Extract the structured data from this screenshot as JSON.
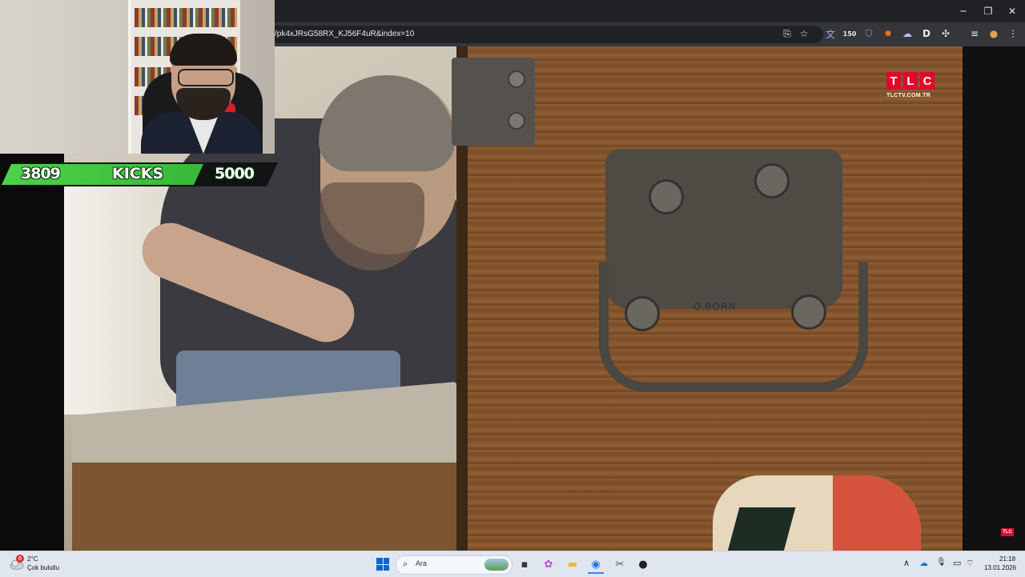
{
  "browser": {
    "url": "/pk4xJRsG58RX_KJ56F4uR&index=10",
    "window_controls": {
      "minimize": "─",
      "maximize": "❐",
      "close": "✕"
    },
    "toolbar_icons": {
      "install": "⎘",
      "bookmark": "☆",
      "translate": "文",
      "badge_count": "150",
      "shield": "⛉",
      "fox": "✹",
      "cloud": "☁",
      "d_ext": "D",
      "extensions": "✣",
      "media": "≡",
      "profile": "●",
      "menu": "⋮"
    }
  },
  "overlay": {
    "kicks_current": "3809",
    "kicks_label": "KICKS",
    "kicks_goal": "5000",
    "progress": 0.7618
  },
  "video": {
    "logo_letters": [
      "T",
      "L",
      "C"
    ],
    "logo_url": "TLCTV.COM.TR",
    "stamp_text": "O.BORN",
    "corner_logo": "TLC"
  },
  "taskbar": {
    "weather_temp": "2°C",
    "weather_desc": "Çok bulutlu",
    "weather_badge": "6",
    "search_placeholder": "Ara",
    "tray_time": "21:18",
    "tray_date": "13.01.2026",
    "apps": {
      "task_view": "▪",
      "copilot": "✿",
      "explorer": "▬",
      "chrome": "◉",
      "snipping": "✂",
      "obs": "●"
    },
    "tray_icons": {
      "chevron": "∧",
      "cloud": "☁",
      "mic": "🎙",
      "display": "▭",
      "wifi": "⌔",
      "volume": "🔊"
    }
  },
  "colors": {
    "kicks_green": "#37b83a",
    "tlc_red": "#e2062c",
    "chrome_dark": "#202124"
  }
}
